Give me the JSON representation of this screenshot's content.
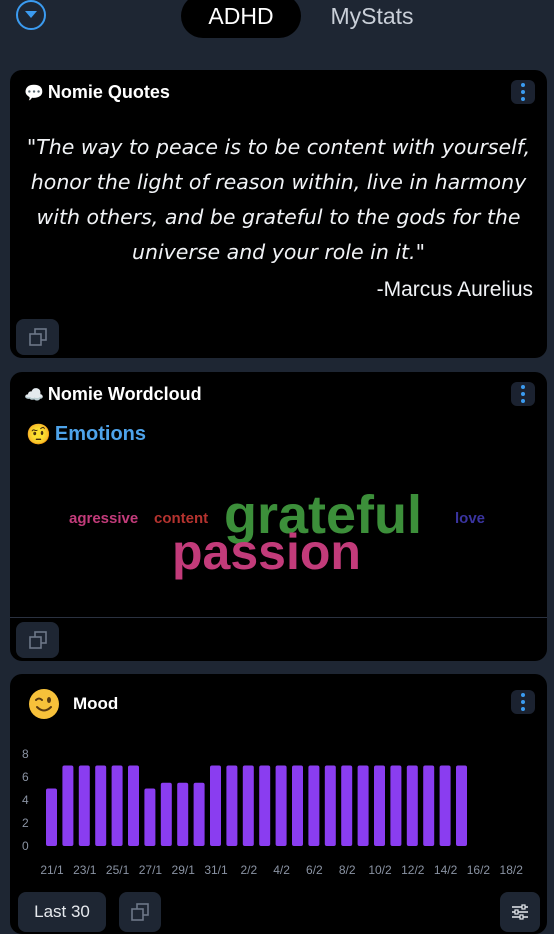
{
  "header": {
    "menu_icon": "chevron-down-circle-icon",
    "tabs": [
      {
        "label": "ADHD",
        "active": true
      },
      {
        "label": "MyStats",
        "active": false
      }
    ]
  },
  "quotes_card": {
    "title_icon": "speech-bubble-icon",
    "title": "Nomie Quotes",
    "quote": "\"The way to peace is to be content with yourself, honor the light of reason within, live in harmony with others, and be grateful to the gods for the universe and your role in it.\"",
    "author": "-Marcus Aurelius"
  },
  "wordcloud_card": {
    "title_icon": "cloud-icon",
    "title": "Nomie Wordcloud",
    "subtitle_icon": "face-with-raised-eyebrow-icon",
    "subtitle": "Emotions",
    "words": [
      {
        "text": "agressive",
        "color": "#c23b7a"
      },
      {
        "text": "content",
        "color": "#b5332f"
      },
      {
        "text": "grateful",
        "color": "#3c8f3a"
      },
      {
        "text": "love",
        "color": "#3a34a0"
      },
      {
        "text": "passion",
        "color": "#c23b7a"
      }
    ]
  },
  "mood_card": {
    "title_icon": "winking-face-icon",
    "title": "Mood",
    "range_button": "Last 30",
    "accent": "#8a3df0"
  },
  "chart_data": {
    "type": "bar",
    "yticks": [
      8,
      6,
      4,
      2,
      0
    ],
    "ylim": [
      0,
      8
    ],
    "x_labels": [
      "21/1",
      "23/1",
      "25/1",
      "27/1",
      "29/1",
      "31/1",
      "2/2",
      "4/2",
      "6/2",
      "8/2",
      "10/2",
      "12/2",
      "14/2",
      "16/2",
      "18/2"
    ],
    "values": [
      5,
      7,
      7,
      7,
      7,
      7,
      5,
      5.5,
      5.5,
      5.5,
      7,
      7,
      7,
      7,
      7,
      7,
      7,
      7,
      7,
      7,
      7,
      7,
      7,
      7,
      7,
      7
    ],
    "color": "#8a3df0"
  }
}
